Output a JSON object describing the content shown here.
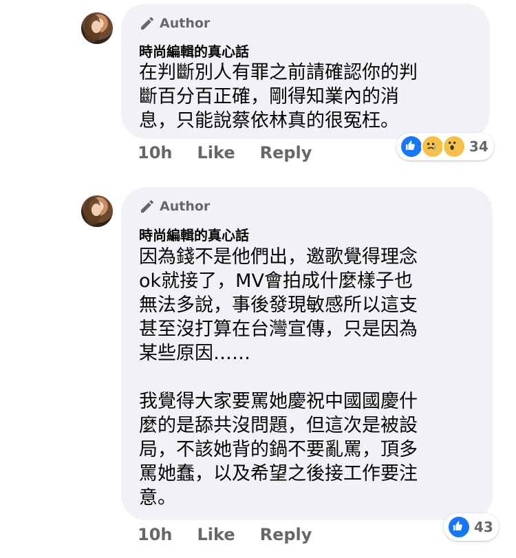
{
  "comments": [
    {
      "badge": "Author",
      "name": "時尚編輯的真心話",
      "text": "在判斷別人有罪之前請確認你的判\n斷百分百正確，剛得知業內的消\n息，只能說蔡依林真的很冤枉。",
      "time": "10h",
      "like_label": "Like",
      "reply_label": "Reply",
      "reactions": [
        "like",
        "sad",
        "wow"
      ],
      "reaction_count": "34"
    },
    {
      "badge": "Author",
      "name": "時尚編輯的真心話",
      "text": "因為錢不是他們出，邀歌覺得理念\nok就接了，MV會拍成什麼樣子也\n無法多說，事後發現敏感所以這支\n甚至沒打算在台灣宣傳，只是因為\n某些原因……\n\n我覺得大家要罵她慶祝中國國慶什\n麼的是舔共沒問題，但這次是被設\n局，不該她背的鍋不要亂罵，頂多\n罵她蠢，以及希望之後接工作要注\n意。",
      "time": "10h",
      "like_label": "Like",
      "reply_label": "Reply",
      "reactions": [
        "like"
      ],
      "reaction_count": "43"
    }
  ],
  "colors": {
    "bubble": "#f0f2f5",
    "secondary_text": "#65676b",
    "like_blue": "#1877f2"
  },
  "icons": {
    "badge": "pencil-icon"
  }
}
